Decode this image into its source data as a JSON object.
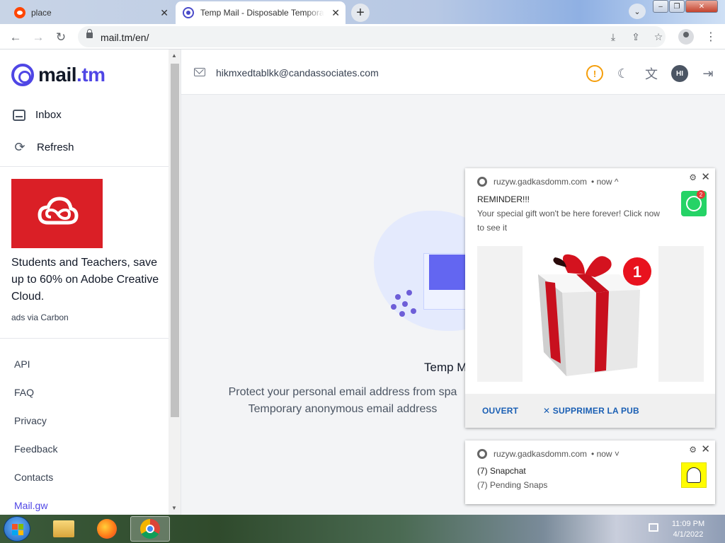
{
  "browser": {
    "tabs": [
      {
        "title": "place",
        "active": false
      },
      {
        "title": "Temp Mail - Disposable Temporary Email",
        "active": true
      }
    ],
    "new_tab_glyph": "+",
    "url": "mail.tm/en/"
  },
  "sidebar": {
    "logo": {
      "prefix": "mail",
      "dot": ".",
      "suffix": "tm"
    },
    "nav": [
      {
        "label": "Inbox",
        "icon": "inbox-icon"
      },
      {
        "label": "Refresh",
        "icon": "refresh-icon"
      }
    ],
    "ad": {
      "text": "Students and Teachers, save up to 60% on Adobe Creative Cloud.",
      "via": "ads via Carbon"
    },
    "links": [
      "API",
      "FAQ",
      "Privacy",
      "Feedback",
      "Contacts",
      "Mail.gw"
    ]
  },
  "header": {
    "email": "hikmxedtablkk@candassociates.com",
    "avatar_initials": "HI",
    "warning_glyph": "!"
  },
  "main": {
    "title": "Temp M",
    "line1": "Protect your personal email address from spa",
    "line2": "Temporary anonymous email address"
  },
  "notifications": [
    {
      "site": "ruzyw.gadkasdomm.com",
      "time": "• now ^",
      "title": "REMINDER!!!",
      "body": "Your special gift won't be here forever! Click now to see it",
      "app_icon": "whatsapp-icon",
      "badge": "2",
      "image_badge": "1",
      "actions": [
        "OUVERT",
        "✕ SUPPRIMER LA PUB"
      ]
    },
    {
      "site": "ruzyw.gadkasdomm.com",
      "time": "• now ˅",
      "title": "(7) Snapchat",
      "body": "(7) Pending Snaps",
      "app_icon": "snapchat-icon"
    }
  ],
  "taskbar": {
    "time": "11:09 PM",
    "date": "4/1/2022"
  },
  "colors": {
    "accent": "#4f46e5",
    "adobe_red": "#da1f26",
    "whatsapp_green": "#25d366",
    "snapchat_yellow": "#fffc00"
  }
}
